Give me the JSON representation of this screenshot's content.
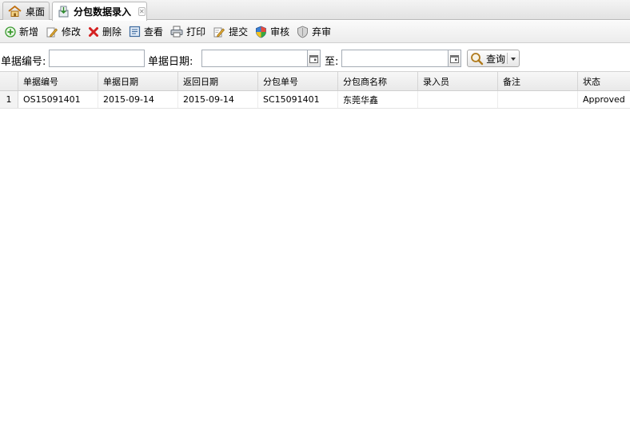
{
  "tabs": [
    {
      "label": "桌面",
      "icon": "home-icon"
    },
    {
      "label": "分包数据录入",
      "icon": "data-entry-icon",
      "closable": true
    }
  ],
  "toolbar": {
    "add": "新增",
    "edit": "修改",
    "delete": "删除",
    "view": "查看",
    "print": "打印",
    "submit": "提交",
    "review": "审核",
    "abandon_review": "弃审"
  },
  "search": {
    "doc_no_label": "单据编号:",
    "doc_no_value": "",
    "doc_date_label": "单据日期:",
    "date_from": "",
    "to_label": "至:",
    "date_to": "",
    "query_label": "查询"
  },
  "grid": {
    "columns": [
      "单据编号",
      "单据日期",
      "返回日期",
      "分包单号",
      "分包商名称",
      "录入员",
      "备注",
      "状态"
    ],
    "rows": [
      {
        "rownum": "1",
        "doc_no": "OS15091401",
        "doc_date": "2015-09-14",
        "return_date": "2015-09-14",
        "sub_no": "SC15091401",
        "supplier": "东莞华鑫",
        "entered_by": "",
        "remark": "",
        "status": "Approved"
      }
    ]
  },
  "colors": {
    "header_bg": "#ececec",
    "border": "#b9b9b9",
    "add_icon": "#3a9a2f",
    "delete_icon": "#d42020"
  }
}
